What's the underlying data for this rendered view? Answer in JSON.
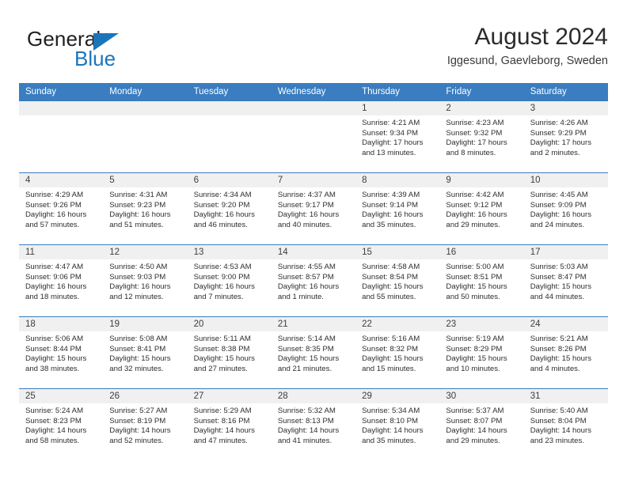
{
  "brand": {
    "name_part1": "General",
    "name_part2": "Blue",
    "accent_color": "#1b75bb"
  },
  "header": {
    "title": "August 2024",
    "subtitle": "Iggesund, Gaevleborg, Sweden"
  },
  "calendar": {
    "header_color": "#3a7dc0",
    "weekday_headers": [
      "Sunday",
      "Monday",
      "Tuesday",
      "Wednesday",
      "Thursday",
      "Friday",
      "Saturday"
    ],
    "weeks": [
      [
        {
          "day": "",
          "lines": []
        },
        {
          "day": "",
          "lines": []
        },
        {
          "day": "",
          "lines": []
        },
        {
          "day": "",
          "lines": []
        },
        {
          "day": "1",
          "lines": [
            "Sunrise: 4:21 AM",
            "Sunset: 9:34 PM",
            "Daylight: 17 hours",
            "and 13 minutes."
          ]
        },
        {
          "day": "2",
          "lines": [
            "Sunrise: 4:23 AM",
            "Sunset: 9:32 PM",
            "Daylight: 17 hours",
            "and 8 minutes."
          ]
        },
        {
          "day": "3",
          "lines": [
            "Sunrise: 4:26 AM",
            "Sunset: 9:29 PM",
            "Daylight: 17 hours",
            "and 2 minutes."
          ]
        }
      ],
      [
        {
          "day": "4",
          "lines": [
            "Sunrise: 4:29 AM",
            "Sunset: 9:26 PM",
            "Daylight: 16 hours",
            "and 57 minutes."
          ]
        },
        {
          "day": "5",
          "lines": [
            "Sunrise: 4:31 AM",
            "Sunset: 9:23 PM",
            "Daylight: 16 hours",
            "and 51 minutes."
          ]
        },
        {
          "day": "6",
          "lines": [
            "Sunrise: 4:34 AM",
            "Sunset: 9:20 PM",
            "Daylight: 16 hours",
            "and 46 minutes."
          ]
        },
        {
          "day": "7",
          "lines": [
            "Sunrise: 4:37 AM",
            "Sunset: 9:17 PM",
            "Daylight: 16 hours",
            "and 40 minutes."
          ]
        },
        {
          "day": "8",
          "lines": [
            "Sunrise: 4:39 AM",
            "Sunset: 9:14 PM",
            "Daylight: 16 hours",
            "and 35 minutes."
          ]
        },
        {
          "day": "9",
          "lines": [
            "Sunrise: 4:42 AM",
            "Sunset: 9:12 PM",
            "Daylight: 16 hours",
            "and 29 minutes."
          ]
        },
        {
          "day": "10",
          "lines": [
            "Sunrise: 4:45 AM",
            "Sunset: 9:09 PM",
            "Daylight: 16 hours",
            "and 24 minutes."
          ]
        }
      ],
      [
        {
          "day": "11",
          "lines": [
            "Sunrise: 4:47 AM",
            "Sunset: 9:06 PM",
            "Daylight: 16 hours",
            "and 18 minutes."
          ]
        },
        {
          "day": "12",
          "lines": [
            "Sunrise: 4:50 AM",
            "Sunset: 9:03 PM",
            "Daylight: 16 hours",
            "and 12 minutes."
          ]
        },
        {
          "day": "13",
          "lines": [
            "Sunrise: 4:53 AM",
            "Sunset: 9:00 PM",
            "Daylight: 16 hours",
            "and 7 minutes."
          ]
        },
        {
          "day": "14",
          "lines": [
            "Sunrise: 4:55 AM",
            "Sunset: 8:57 PM",
            "Daylight: 16 hours",
            "and 1 minute."
          ]
        },
        {
          "day": "15",
          "lines": [
            "Sunrise: 4:58 AM",
            "Sunset: 8:54 PM",
            "Daylight: 15 hours",
            "and 55 minutes."
          ]
        },
        {
          "day": "16",
          "lines": [
            "Sunrise: 5:00 AM",
            "Sunset: 8:51 PM",
            "Daylight: 15 hours",
            "and 50 minutes."
          ]
        },
        {
          "day": "17",
          "lines": [
            "Sunrise: 5:03 AM",
            "Sunset: 8:47 PM",
            "Daylight: 15 hours",
            "and 44 minutes."
          ]
        }
      ],
      [
        {
          "day": "18",
          "lines": [
            "Sunrise: 5:06 AM",
            "Sunset: 8:44 PM",
            "Daylight: 15 hours",
            "and 38 minutes."
          ]
        },
        {
          "day": "19",
          "lines": [
            "Sunrise: 5:08 AM",
            "Sunset: 8:41 PM",
            "Daylight: 15 hours",
            "and 32 minutes."
          ]
        },
        {
          "day": "20",
          "lines": [
            "Sunrise: 5:11 AM",
            "Sunset: 8:38 PM",
            "Daylight: 15 hours",
            "and 27 minutes."
          ]
        },
        {
          "day": "21",
          "lines": [
            "Sunrise: 5:14 AM",
            "Sunset: 8:35 PM",
            "Daylight: 15 hours",
            "and 21 minutes."
          ]
        },
        {
          "day": "22",
          "lines": [
            "Sunrise: 5:16 AM",
            "Sunset: 8:32 PM",
            "Daylight: 15 hours",
            "and 15 minutes."
          ]
        },
        {
          "day": "23",
          "lines": [
            "Sunrise: 5:19 AM",
            "Sunset: 8:29 PM",
            "Daylight: 15 hours",
            "and 10 minutes."
          ]
        },
        {
          "day": "24",
          "lines": [
            "Sunrise: 5:21 AM",
            "Sunset: 8:26 PM",
            "Daylight: 15 hours",
            "and 4 minutes."
          ]
        }
      ],
      [
        {
          "day": "25",
          "lines": [
            "Sunrise: 5:24 AM",
            "Sunset: 8:23 PM",
            "Daylight: 14 hours",
            "and 58 minutes."
          ]
        },
        {
          "day": "26",
          "lines": [
            "Sunrise: 5:27 AM",
            "Sunset: 8:19 PM",
            "Daylight: 14 hours",
            "and 52 minutes."
          ]
        },
        {
          "day": "27",
          "lines": [
            "Sunrise: 5:29 AM",
            "Sunset: 8:16 PM",
            "Daylight: 14 hours",
            "and 47 minutes."
          ]
        },
        {
          "day": "28",
          "lines": [
            "Sunrise: 5:32 AM",
            "Sunset: 8:13 PM",
            "Daylight: 14 hours",
            "and 41 minutes."
          ]
        },
        {
          "day": "29",
          "lines": [
            "Sunrise: 5:34 AM",
            "Sunset: 8:10 PM",
            "Daylight: 14 hours",
            "and 35 minutes."
          ]
        },
        {
          "day": "30",
          "lines": [
            "Sunrise: 5:37 AM",
            "Sunset: 8:07 PM",
            "Daylight: 14 hours",
            "and 29 minutes."
          ]
        },
        {
          "day": "31",
          "lines": [
            "Sunrise: 5:40 AM",
            "Sunset: 8:04 PM",
            "Daylight: 14 hours",
            "and 23 minutes."
          ]
        }
      ]
    ]
  }
}
